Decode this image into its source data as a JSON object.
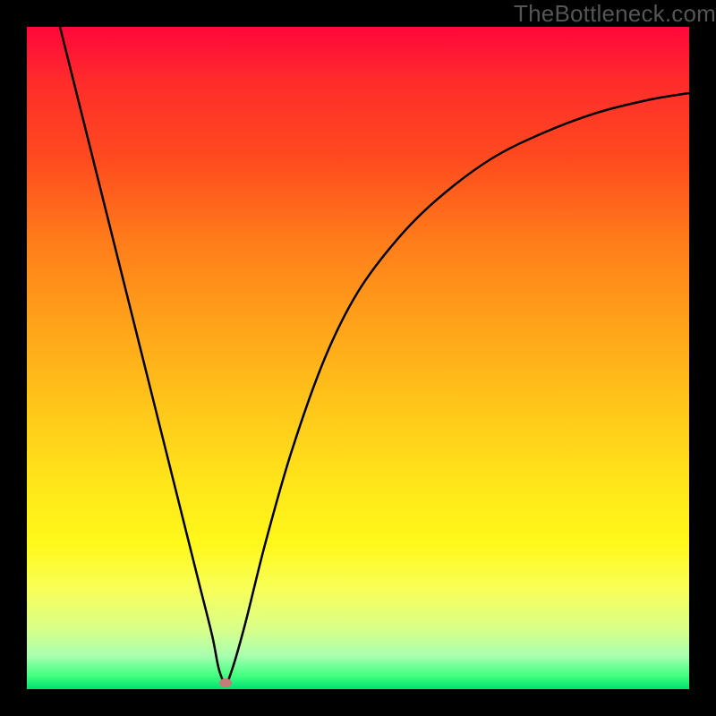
{
  "watermark": "TheBottleneck.com",
  "chart_data": {
    "type": "line",
    "title": "",
    "xlabel": "",
    "ylabel": "",
    "xlim": [
      0,
      100
    ],
    "ylim": [
      0,
      100
    ],
    "grid": false,
    "background_gradient": [
      "#ff073a",
      "#ff4b1f",
      "#ffa31a",
      "#ffe81a",
      "#f8ff5a",
      "#40ff80",
      "#00e070"
    ],
    "series": [
      {
        "name": "bottleneck-curve",
        "color": "#000000",
        "x": [
          5,
          8,
          12,
          16,
          20,
          24,
          26,
          28,
          29,
          30,
          31,
          33,
          36,
          40,
          45,
          50,
          56,
          62,
          70,
          78,
          86,
          94,
          100
        ],
        "y": [
          100,
          88,
          72,
          56,
          40,
          24,
          16,
          8,
          3,
          1,
          3,
          10,
          22,
          36,
          50,
          60,
          68,
          74,
          80,
          84,
          87,
          89,
          90
        ]
      }
    ],
    "annotations": [
      {
        "name": "minimum-point",
        "x": 30,
        "y": 1,
        "marker": "ellipse",
        "color": "#c97a7a"
      }
    ]
  }
}
